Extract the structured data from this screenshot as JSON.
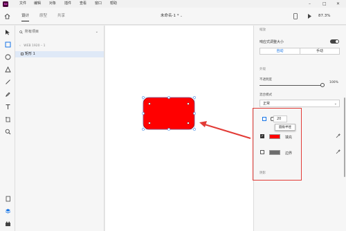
{
  "app": {
    "logo": "Xd"
  },
  "menu": [
    "文件",
    "编辑",
    "对象",
    "插件",
    "查看",
    "窗口",
    "帮助"
  ],
  "tabs": [
    {
      "label": "设计",
      "active": true
    },
    {
      "label": "原型",
      "active": false
    },
    {
      "label": "共享",
      "active": false
    }
  ],
  "document": {
    "title": "未命名-1 *"
  },
  "toolbar": {
    "zoom": "87.3%"
  },
  "layers": {
    "search_placeholder": "所有项目",
    "artboard": "WEB 1920 – 1",
    "items": [
      {
        "label": "矩形 1"
      }
    ]
  },
  "props": {
    "section_layout": "缩放",
    "responsive_label": "响应式调整大小",
    "mode_auto": "自动",
    "mode_manual": "手动",
    "section_appearance": "外观",
    "opacity_label": "不透明度",
    "opacity_value": "100%",
    "opacity_fraction": 1.0,
    "blend_label": "混合模式",
    "blend_value": "正常",
    "corner_radius": "20",
    "corner_tooltip": "圆角半径",
    "fill_label": "填充",
    "fill_color": "#ff0000",
    "fill_checked": true,
    "border_label": "边界",
    "border_color": "#6e6e6e",
    "border_checked": false,
    "section_shadow": "阴影"
  },
  "colors": {
    "accent": "#1473e6",
    "rect_fill": "#ff0000",
    "annotation": "#e23b36"
  }
}
